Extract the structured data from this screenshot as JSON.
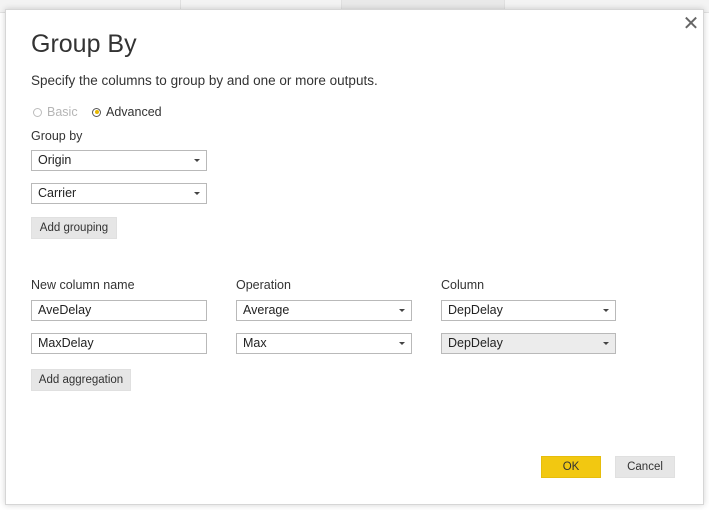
{
  "dialog": {
    "title": "Group By",
    "subtitle": "Specify the columns to group by and one or more outputs.",
    "close_icon": "✕"
  },
  "mode": {
    "basic_label": "Basic",
    "advanced_label": "Advanced",
    "selected": "Advanced"
  },
  "group_by": {
    "label": "Group by",
    "fields": [
      "Origin",
      "Carrier"
    ],
    "add_label": "Add grouping"
  },
  "aggregations": {
    "headers": {
      "new_column_name": "New column name",
      "operation": "Operation",
      "column": "Column"
    },
    "rows": [
      {
        "name": "AveDelay",
        "operation": "Average",
        "column": "DepDelay"
      },
      {
        "name": "MaxDelay",
        "operation": "Max",
        "column": "DepDelay"
      }
    ],
    "add_label": "Add aggregation"
  },
  "footer": {
    "ok_label": "OK",
    "cancel_label": "Cancel"
  },
  "colors": {
    "accent": "#f2c811",
    "radio_dot": "#e7b800"
  }
}
